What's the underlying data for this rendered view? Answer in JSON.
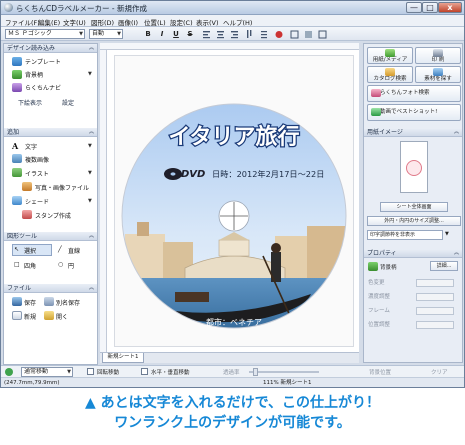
{
  "window": {
    "title": "らくちんCDラベルメーカー - 新規作成",
    "controls": {
      "minimize": "—",
      "maximize": "□",
      "close": "x"
    }
  },
  "menu": [
    "ファイル(F)",
    "編集(E)",
    "文字(U)",
    "図形(D)",
    "画像(I)",
    "位置(L)",
    "設定(C)",
    "表示(V)",
    "ヘルプ(H)"
  ],
  "toolbar": {
    "font_name": "ＭＳ Ｐゴシック",
    "font_size": "自動",
    "bold": "B",
    "italic": "I",
    "underline": "U",
    "strike": "S"
  },
  "left_panel": {
    "design": {
      "header": "デザイン読み込み",
      "items": [
        "テンプレート",
        "背景柄",
        "らくちんナビ"
      ],
      "links": [
        "下絵表示",
        "設定"
      ]
    },
    "add": {
      "header": "追加",
      "items": [
        "文字",
        "複数画像",
        "イラスト",
        "写真・画像ファイル",
        "シェード",
        "スタンプ作成"
      ]
    },
    "shape_tools": {
      "header": "図形ツール",
      "items": [
        "選択",
        "直線",
        "四角",
        "円"
      ]
    },
    "file": {
      "header": "ファイル",
      "items": [
        "保存",
        "別名保存",
        "新規",
        "開く"
      ]
    }
  },
  "label": {
    "title": "イタリア旅行",
    "logo": "DVD",
    "date": "日時：2012年2月17日～22日",
    "location": "都市：ベネチア"
  },
  "sheet_tab": "新規シート1",
  "right_panel": {
    "buttons": [
      "用紙/メディア",
      "印 刷",
      "カタログ検索",
      "素材を探す",
      "らくちんフォト検索",
      "動画でベストショット!"
    ],
    "paper_image": {
      "header": "用紙イメージ",
      "sheet_button": "シート全体画面",
      "outer_inner": "外円・内円のサイズ調整...",
      "print_frame": "印字調節枠を非表示"
    },
    "properties": {
      "header": "プロパティ",
      "bg_label": "背景柄",
      "detail_button": "詳細...",
      "rows": [
        "色変更",
        "濃度調整",
        "フレーム",
        "位置調整"
      ]
    }
  },
  "status": {
    "mode": "通常移動",
    "rotate": "回転移動",
    "align": "水平・垂直移動",
    "zoom_label": "透過率",
    "bg_position": "背景位置",
    "clear": "クリア",
    "coords": "(247.7mm,79.9mm)",
    "sheet_info": "111% 新規シート1"
  },
  "caption": {
    "line1": "あとは文字を入れるだけで、この仕上がり！",
    "line2": "ワンランク上のデザインが可能です。"
  },
  "colors": {
    "title_text": "#1a3a78",
    "caption": "#1688d6",
    "sky": "#c8dcf4",
    "water": "#3d7fb5"
  }
}
